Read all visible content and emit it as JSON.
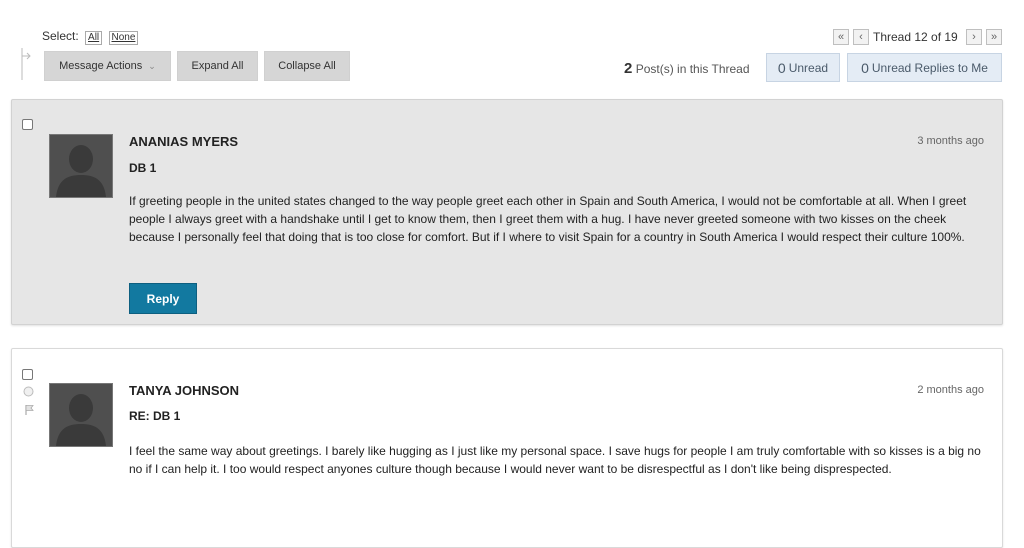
{
  "toolbar": {
    "select_label": "Select:",
    "select_all": "All",
    "select_none": "None",
    "message_actions": "Message Actions",
    "expand_all": "Expand All",
    "collapse_all": "Collapse All"
  },
  "pager": {
    "thread_label": "Thread 12 of 19",
    "first_icon": "double-left",
    "prev_icon": "left",
    "next_icon": "right",
    "last_icon": "double-right"
  },
  "thread_stats": {
    "post_count": "2",
    "post_count_label": "Post(s) in this Thread",
    "unread_count": "0",
    "unread_label": "Unread",
    "unread_replies_count": "0",
    "unread_replies_label": "Unread Replies to Me"
  },
  "colors": {
    "reply_button": "#1279a0",
    "unread_button_bg": "#e4ecf5",
    "post_selected_bg": "#e6e6e6"
  },
  "posts": [
    {
      "author": "ANANIAS MYERS",
      "subject": "DB 1",
      "time": "3 months ago",
      "body": "If greeting people in the united states changed to the way people greet each other in Spain and South America, I would not be comfortable at all. When I greet people I always greet with a handshake until I get to know them, then I greet them with a hug. I have never greeted someone with two kisses on the cheek because I personally feel that doing that is too close for comfort. But if I where to visit Spain for a country in South America I would respect their culture 100%.",
      "reply_label": "Reply"
    },
    {
      "author": "TANYA JOHNSON",
      "subject": "RE: DB 1",
      "time": "2 months ago",
      "body": "I feel the same way about greetings. I barely like hugging as I just like my personal space. I save hugs for people I am truly comfortable with so kisses is a big no no if I can help it. I too would respect anyones culture though because I would never want to be disrespectful as I don't like being disprespected."
    }
  ]
}
